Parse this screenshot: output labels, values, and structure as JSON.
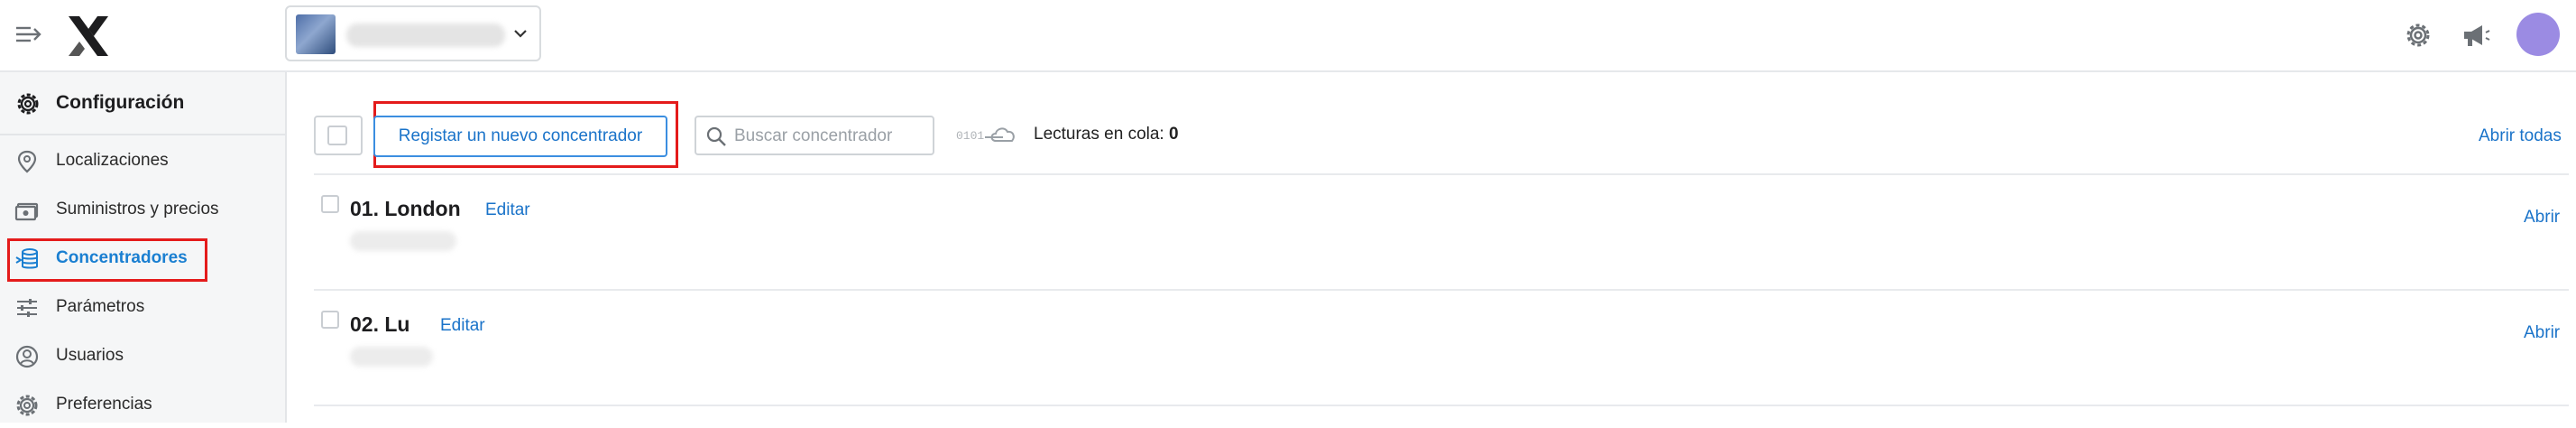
{
  "header": {
    "account_name": "",
    "icons": [
      "menu-toggle-icon",
      "logo-icon",
      "chevron-down-icon",
      "settings-icon",
      "megaphone-icon",
      "avatar"
    ]
  },
  "sidebar": {
    "title": "Configuración",
    "items": [
      {
        "label": "Localizaciones",
        "icon": "location-pin-icon"
      },
      {
        "label": "Suministros y precios",
        "icon": "money-icon"
      },
      {
        "label": "Concentradores",
        "icon": "concentrator-icon",
        "active": true
      },
      {
        "label": "Parámetros",
        "icon": "sliders-icon"
      },
      {
        "label": "Usuarios",
        "icon": "user-icon"
      },
      {
        "label": "Preferencias",
        "icon": "gear-icon"
      }
    ]
  },
  "toolbar": {
    "register_label": "Registar un nuevo concentrador",
    "search_placeholder": "Buscar concentrador",
    "queue_icon_text": "0101",
    "queue_label": "Lecturas en cola:",
    "queue_value": "0",
    "open_all_label": "Abrir todas"
  },
  "concentrators": [
    {
      "title": "01. London",
      "edit_label": "Editar",
      "open_label": "Abrir"
    },
    {
      "title": "02. Lu",
      "edit_label": "Editar",
      "open_label": "Abrir"
    }
  ],
  "colors": {
    "accent": "#1a73c9",
    "highlight": "#e41b1b",
    "avatar": "#9b8be3"
  }
}
